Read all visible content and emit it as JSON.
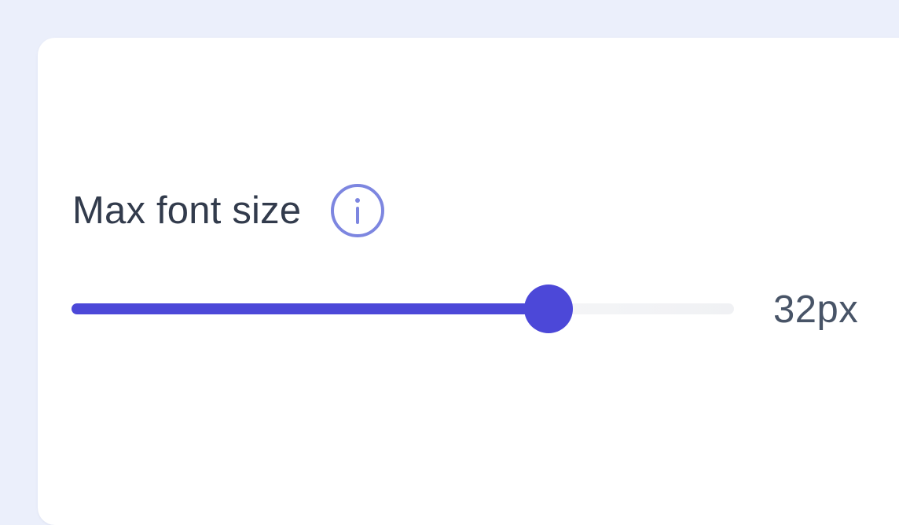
{
  "setting": {
    "label": "Max font size",
    "info_icon": "info-circle-icon",
    "value_text": "32px",
    "slider_fraction": 0.72
  },
  "colors": {
    "background": "#ebeffb",
    "card": "#ffffff",
    "accent": "#4c48d8",
    "info_icon": "#7d86e0",
    "label_text": "#323b4c",
    "value_text": "#485467",
    "track": "#f0f1f4"
  }
}
